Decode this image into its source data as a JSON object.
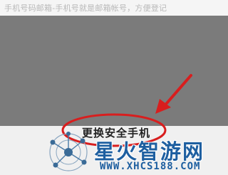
{
  "header": {
    "hint_text": "手机号码邮箱-手机号就是邮箱帐号，方便登记"
  },
  "sheet": {
    "change_phone_label": "更换安全手机"
  },
  "watermark": {
    "title": "星火智游网",
    "url": "WWW.XHCS188.COM"
  },
  "colors": {
    "annotation": "#d81e1e",
    "overlay": "#7b7b7b",
    "watermark": "#1e5fa0"
  },
  "icons": {
    "arrow": "arrow-pointer-icon",
    "circle": "highlight-circle-icon",
    "logo": "network-globe-icon"
  }
}
